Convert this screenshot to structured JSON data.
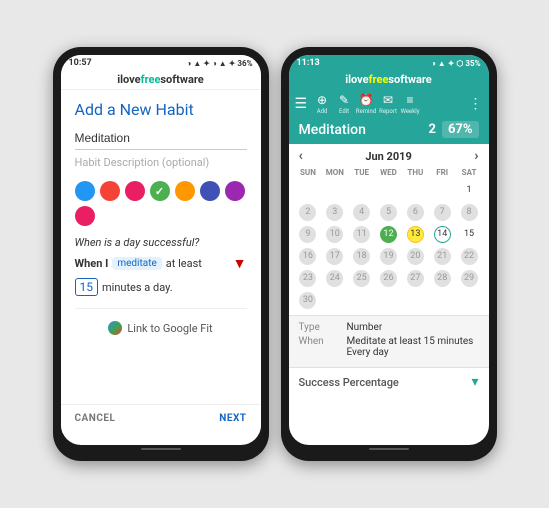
{
  "site": {
    "name_prefix": "ilove",
    "name_highlight": "free",
    "name_suffix": "software"
  },
  "phone1": {
    "status": {
      "time": "10:57",
      "icons": "◑ ▲ ✦ 36%"
    },
    "title": "Add a New Habit",
    "habit_name": "Meditation",
    "description_placeholder": "Habit Description (optional)",
    "colors": [
      {
        "color": "#2196f3",
        "check": false
      },
      {
        "color": "#f44336",
        "check": false
      },
      {
        "color": "#e91e63",
        "check": false
      },
      {
        "color": "#4caf50",
        "check": true
      },
      {
        "color": "#ff9800",
        "check": false
      },
      {
        "color": "#3f51b5",
        "check": false
      },
      {
        "color": "#9c27b0",
        "check": false
      },
      {
        "color": "#e91e63",
        "check": false
      }
    ],
    "question": "When is a day successful?",
    "when_label": "When I",
    "when_action": "meditate",
    "when_qualifier": "at least",
    "minutes_value": "15",
    "minutes_label": "minutes a day.",
    "google_fit_label": "Link to Google Fit",
    "cancel_label": "CANCEL",
    "next_label": "NEXT"
  },
  "phone2": {
    "status": {
      "time": "11:13",
      "icons": "◑ ▲ ✦ ⬡ 35%"
    },
    "toolbar": {
      "items": [
        {
          "icon": "☰",
          "label": ""
        },
        {
          "icon": "⊕",
          "label": "Add"
        },
        {
          "icon": "✎",
          "label": "Edit"
        },
        {
          "icon": "⏰",
          "label": "Remind"
        },
        {
          "icon": "✉",
          "label": "Report"
        },
        {
          "icon": "≡",
          "label": "Weekly"
        }
      ],
      "more": "⋮"
    },
    "habit_name": "Meditation",
    "streak": "2",
    "percentage": "67%",
    "calendar": {
      "month_label": "Jun 2019",
      "headers": [
        "SUN",
        "MON",
        "TUE",
        "WED",
        "THU",
        "FRI",
        "SAT"
      ],
      "weeks": [
        [
          {
            "n": "",
            "type": "empty"
          },
          {
            "n": "",
            "type": "empty"
          },
          {
            "n": "",
            "type": "empty"
          },
          {
            "n": "",
            "type": "empty"
          },
          {
            "n": "",
            "type": "empty"
          },
          {
            "n": "",
            "type": "empty"
          },
          {
            "n": "1",
            "type": "plain"
          }
        ],
        [
          {
            "n": "2",
            "type": "empty"
          },
          {
            "n": "3",
            "type": "empty"
          },
          {
            "n": "4",
            "type": "empty"
          },
          {
            "n": "5",
            "type": "empty"
          },
          {
            "n": "6",
            "type": "empty"
          },
          {
            "n": "7",
            "type": "empty"
          },
          {
            "n": "8",
            "type": "empty"
          }
        ],
        [
          {
            "n": "9",
            "type": "empty"
          },
          {
            "n": "10",
            "type": "empty"
          },
          {
            "n": "11",
            "type": "empty"
          },
          {
            "n": "12",
            "type": "filled-green"
          },
          {
            "n": "13",
            "type": "filled-yellow"
          },
          {
            "n": "14",
            "type": "today-outline"
          },
          {
            "n": "15",
            "type": "plain"
          }
        ],
        [
          {
            "n": "16",
            "type": "empty"
          },
          {
            "n": "17",
            "type": "empty"
          },
          {
            "n": "18",
            "type": "empty"
          },
          {
            "n": "19",
            "type": "empty"
          },
          {
            "n": "20",
            "type": "empty"
          },
          {
            "n": "21",
            "type": "empty"
          },
          {
            "n": "22",
            "type": "empty"
          }
        ],
        [
          {
            "n": "23",
            "type": "empty"
          },
          {
            "n": "24",
            "type": "empty"
          },
          {
            "n": "25",
            "type": "empty"
          },
          {
            "n": "26",
            "type": "empty"
          },
          {
            "n": "27",
            "type": "empty"
          },
          {
            "n": "28",
            "type": "empty"
          },
          {
            "n": "29",
            "type": "empty"
          }
        ],
        [
          {
            "n": "30",
            "type": "empty"
          },
          {
            "n": "",
            "type": ""
          },
          {
            "n": "",
            "type": ""
          },
          {
            "n": "",
            "type": ""
          },
          {
            "n": "",
            "type": ""
          },
          {
            "n": "",
            "type": ""
          },
          {
            "n": "",
            "type": ""
          }
        ]
      ]
    },
    "info": {
      "type_label": "Type",
      "type_value": "Number",
      "when_label": "When",
      "when_value": "Meditate at least 15 minutes",
      "freq_label": "",
      "freq_value": "Every day"
    },
    "success_label": "Success Percentage"
  }
}
